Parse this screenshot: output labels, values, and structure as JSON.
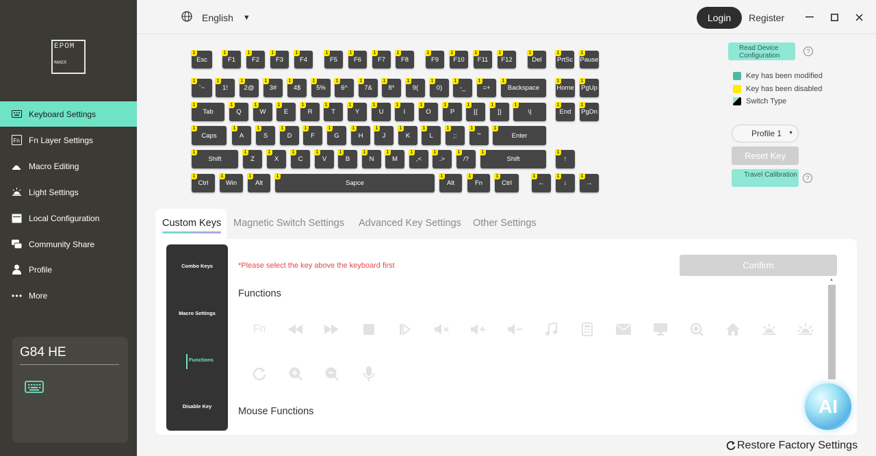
{
  "sidebar": {
    "logo": {
      "line1": "EPOM",
      "line2": "MAKER"
    },
    "items": [
      {
        "label": "Keyboard Settings",
        "icon": "keyboard-icon"
      },
      {
        "label": "Fn Layer Settings",
        "icon": "fn-icon"
      },
      {
        "label": "Macro Editing",
        "icon": "macro-icon"
      },
      {
        "label": "Light Settings",
        "icon": "light-icon"
      },
      {
        "label": "Local Configuration",
        "icon": "local-config-icon"
      },
      {
        "label": "Community Share",
        "icon": "community-icon"
      },
      {
        "label": "Profile",
        "icon": "user-icon"
      },
      {
        "label": "More",
        "icon": "more-icon"
      }
    ],
    "device": {
      "name": "G84 HE",
      "icon": "keyboard-icon"
    }
  },
  "header": {
    "language": "English",
    "login": "Login",
    "register": "Register"
  },
  "keyboard": {
    "layer_badge": "1",
    "rows": [
      [
        "Esc",
        "F1",
        "F2",
        "F3",
        "F4",
        "F5",
        "F6",
        "F7",
        "F8",
        "F9",
        "F10",
        "F11",
        "F12",
        "Del",
        "PrtSc",
        "Pause"
      ],
      [
        "`~",
        "1!",
        "2@",
        "3#",
        "4$",
        "5%",
        "6^",
        "7&",
        "8*",
        "9(",
        "0)",
        "-_",
        "=+",
        "Backspace",
        "Home",
        "PgUp"
      ],
      [
        "Tab",
        "Q",
        "W",
        "E",
        "R",
        "T",
        "Y",
        "U",
        "I",
        "O",
        "P",
        "[{",
        "]}",
        "\\|",
        "End",
        "PgDn"
      ],
      [
        "Caps",
        "A",
        "S",
        "D",
        "F",
        "G",
        "H",
        "J",
        "K",
        "L",
        ";:",
        "'\"",
        "Enter"
      ],
      [
        "Shift",
        "Z",
        "X",
        "C",
        "V",
        "B",
        "N",
        "M",
        ",<",
        ".>",
        "/?",
        "Shift",
        "↑"
      ],
      [
        "Ctrl",
        "Win",
        "Alt",
        "Sapce",
        "Alt",
        "Fn",
        "Ctrl",
        "←",
        "↓",
        "→"
      ]
    ]
  },
  "right_panel": {
    "read_device": "Read Device Configuration",
    "legend": [
      {
        "label": "Key has been modified",
        "color": "#4fb8a5"
      },
      {
        "label": "Key has been disabled",
        "color": "#ffea00"
      },
      {
        "label": "Switch Type",
        "color": "#000000"
      }
    ],
    "profile": "Profile 1",
    "reset_key": "Reset Key",
    "travel_calibration": "Travel Calibration"
  },
  "tabs": [
    "Custom Keys",
    "Magnetic Switch Settings",
    "Advanced Key Settings",
    "Other Settings"
  ],
  "panel": {
    "sub_menu": [
      "Combo Keys",
      "Macro Settings",
      "Functions",
      "Disable Key"
    ],
    "hint": "*Please select the key above the keyboard first",
    "confirm": "Confirm",
    "functions_title": "Functions",
    "fn_label": "Fn",
    "function_icons": [
      "fn-icon",
      "previous-track-icon",
      "next-track-icon",
      "stop-icon",
      "play-pause-icon",
      "mute-icon",
      "volume-up-icon",
      "volume-down-icon",
      "music-icon",
      "calculator-icon",
      "mail-icon",
      "computer-icon",
      "search-icon",
      "home-icon",
      "brightness-down-icon",
      "brightness-up-icon",
      "refresh-icon",
      "zoom-in-icon",
      "zoom-out-icon",
      "microphone-icon"
    ],
    "mouse_functions_title": "Mouse Functions"
  },
  "ai_label": "AI",
  "restore": "Restore Factory Settings"
}
